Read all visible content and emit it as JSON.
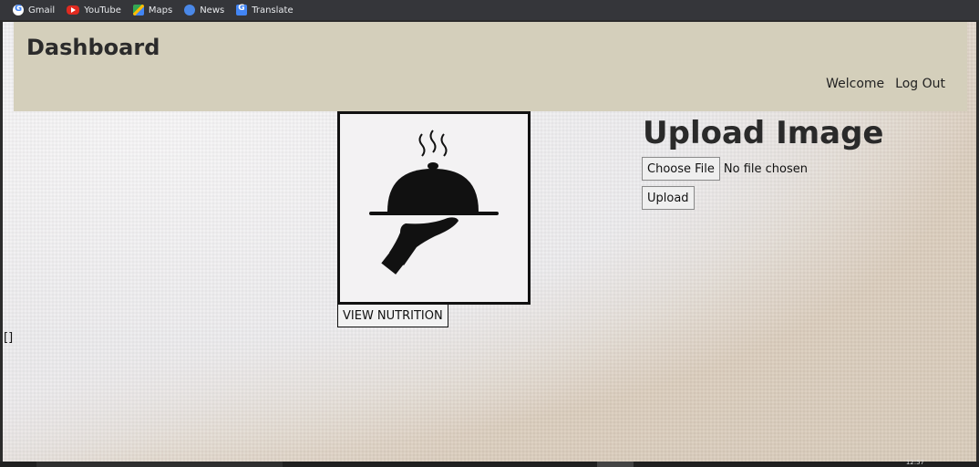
{
  "bookmarks": [
    {
      "label": "Gmail",
      "icon": "gmail-icon"
    },
    {
      "label": "YouTube",
      "icon": "youtube-icon"
    },
    {
      "label": "Maps",
      "icon": "maps-icon"
    },
    {
      "label": "News",
      "icon": "news-icon"
    },
    {
      "label": "Translate",
      "icon": "translate-icon"
    }
  ],
  "header": {
    "title": "Dashboard",
    "nav": {
      "welcome": "Welcome",
      "logout": "Log Out"
    },
    "background_color": "#d4cfbb"
  },
  "main": {
    "food_image": {
      "icon": "serving-cloche-icon"
    },
    "view_nutrition_label": "VIEW NUTRITION",
    "debug_text": "[]"
  },
  "upload": {
    "title": "Upload Image",
    "choose_file_label": "Choose File",
    "no_file_text": "No file chosen",
    "upload_label": "Upload"
  },
  "taskbar": {
    "clock": "12:57"
  }
}
